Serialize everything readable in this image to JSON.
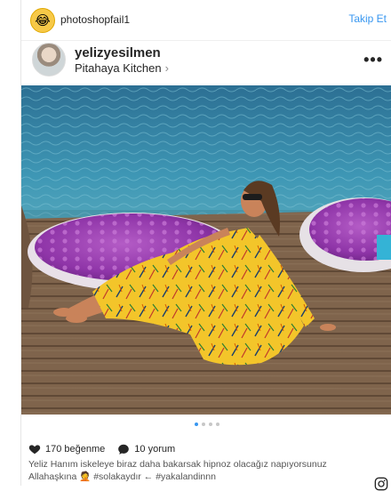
{
  "top": {
    "username": "photoshopfail1",
    "follow_label": "Takip Et"
  },
  "post": {
    "username": "yelizyesilmen",
    "location": "Pitahaya Kitchen",
    "more_label": "•••"
  },
  "carousel": {
    "count": 4,
    "active": 0
  },
  "stats": {
    "likes": "170 beğenme",
    "comments": "10 yorum"
  },
  "caption": {
    "line1": "Yeliz Hanım iskeleye biraz daha bakarsak hipnoz olacağız napıyorsunuz",
    "line2": "Allahaşkına 🤦 #solakaydır ← #yakalandinnn"
  },
  "icons": {
    "emoji": "laughing-emoji-icon",
    "heart": "heart-icon",
    "comment": "comment-icon",
    "instagram": "instagram-icon"
  },
  "colors": {
    "link": "#3897f0",
    "sea": "#3f8fb0",
    "dress": "#f3c52a",
    "float": "#9b3fb0"
  }
}
